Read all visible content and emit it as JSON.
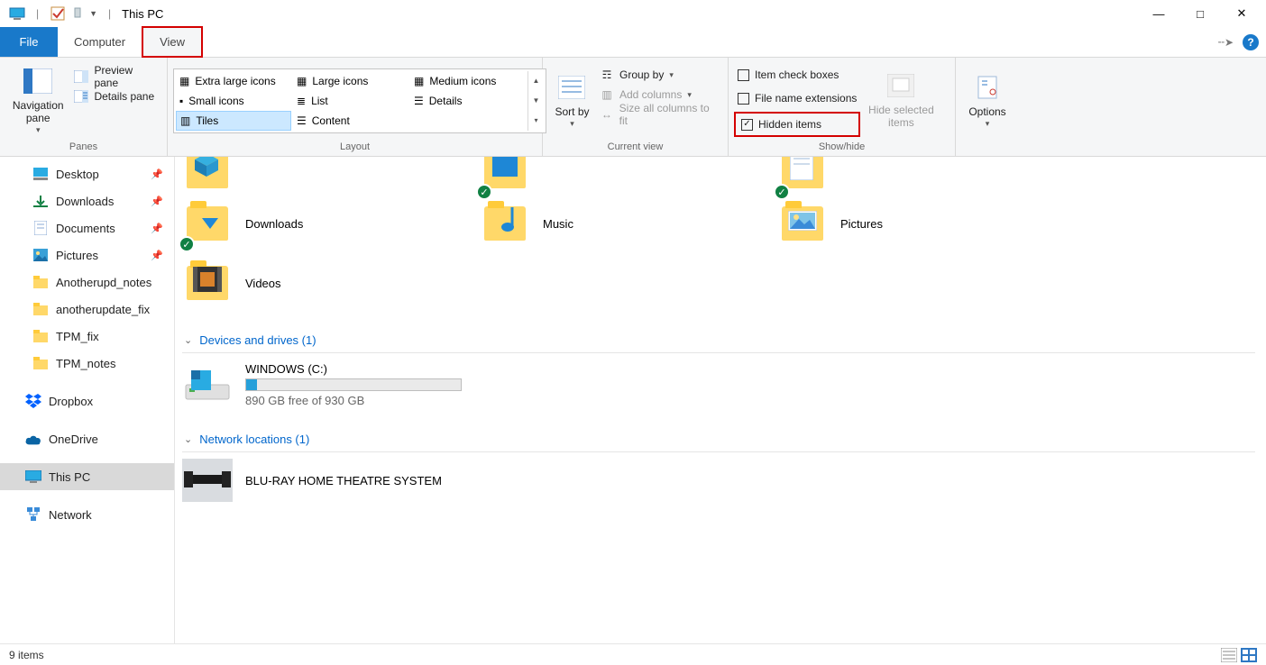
{
  "title": "This PC",
  "tabs": {
    "file": "File",
    "computer": "Computer",
    "view": "View"
  },
  "ribbon": {
    "panes": {
      "nav": "Navigation pane",
      "preview": "Preview pane",
      "details": "Details pane",
      "group": "Panes"
    },
    "layout": {
      "xl": "Extra large icons",
      "l": "Large icons",
      "m": "Medium icons",
      "s": "Small icons",
      "list": "List",
      "details": "Details",
      "tiles": "Tiles",
      "content": "Content",
      "group": "Layout"
    },
    "current": {
      "sort": "Sort by",
      "groupby": "Group by",
      "addcols": "Add columns",
      "sizecols": "Size all columns to fit",
      "group": "Current view"
    },
    "showhide": {
      "itemchk": "Item check boxes",
      "ext": "File name extensions",
      "hidden": "Hidden items",
      "hidesel": "Hide selected items",
      "group": "Show/hide"
    },
    "options": "Options"
  },
  "sidebar": {
    "items": [
      {
        "label": "Desktop",
        "pin": true
      },
      {
        "label": "Downloads",
        "pin": true
      },
      {
        "label": "Documents",
        "pin": true
      },
      {
        "label": "Pictures",
        "pin": true
      },
      {
        "label": "Anotherupd_notes"
      },
      {
        "label": "anotherupdate_fix"
      },
      {
        "label": "TPM_fix"
      },
      {
        "label": "TPM_notes"
      }
    ],
    "dropbox": "Dropbox",
    "onedrive": "OneDrive",
    "thispc": "This PC",
    "network": "Network"
  },
  "folders": {
    "row1": [
      "3D Objects",
      "Desktop",
      "Documents"
    ],
    "row2": [
      "Downloads",
      "Music",
      "Pictures"
    ],
    "videos": "Videos"
  },
  "devices": {
    "head": "Devices and drives (1)",
    "drive_name": "WINDOWS (C:)",
    "drive_free": "890 GB free of 930 GB",
    "fill_pct": 5
  },
  "netloc": {
    "head": "Network locations (1)",
    "item": "BLU-RAY HOME THEATRE SYSTEM"
  },
  "status": {
    "count": "9 items"
  }
}
